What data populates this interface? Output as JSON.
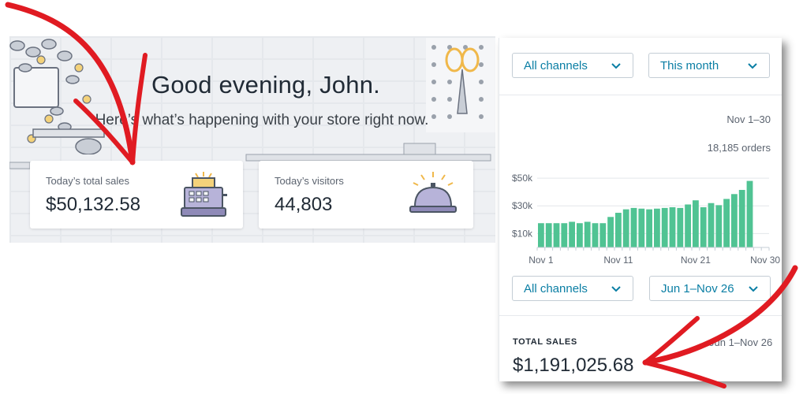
{
  "dashboard": {
    "greeting": "Good evening, John.",
    "subline": "Here’s what’s happening with your store right now.",
    "cards": {
      "sales": {
        "label": "Today’s total sales",
        "value": "$50,132.58"
      },
      "visitors": {
        "label": "Today’s visitors",
        "value": "44,803"
      }
    }
  },
  "orders_panel": {
    "channel_select": "All channels",
    "period_select": "This month",
    "date_range": "Nov 1–30",
    "orders_count": "18,185 orders"
  },
  "chart_data": {
    "type": "bar",
    "x": [
      1,
      2,
      3,
      4,
      5,
      6,
      7,
      8,
      9,
      10,
      11,
      12,
      13,
      14,
      15,
      16,
      17,
      18,
      19,
      20,
      21,
      22,
      23,
      24,
      25,
      26,
      27,
      28,
      29,
      30
    ],
    "values": [
      17500,
      17500,
      17500,
      17500,
      18500,
      17500,
      18500,
      17500,
      17500,
      22000,
      25000,
      27500,
      28500,
      28000,
      27500,
      28000,
      28500,
      29000,
      28500,
      31000,
      34000,
      29000,
      32000,
      30500,
      35000,
      38500,
      41500,
      48000,
      0,
      0
    ],
    "y_ticks": [
      "$10k",
      "$30k",
      "$50k"
    ],
    "x_ticks": [
      "Nov 1",
      "Nov 11",
      "Nov 21",
      "Nov 30"
    ],
    "ylim": [
      0,
      58000
    ],
    "color": "#50c393"
  },
  "sales_panel": {
    "channel_select": "All channels",
    "range_select": "Jun 1–Nov 26",
    "label": "TOTAL SALES",
    "range": "Jun 1–Nov 26",
    "value": "$1,191,025.68"
  },
  "colors": {
    "accent": "#0a7ea4",
    "bar": "#50c393",
    "arrow": "#e01b22"
  }
}
